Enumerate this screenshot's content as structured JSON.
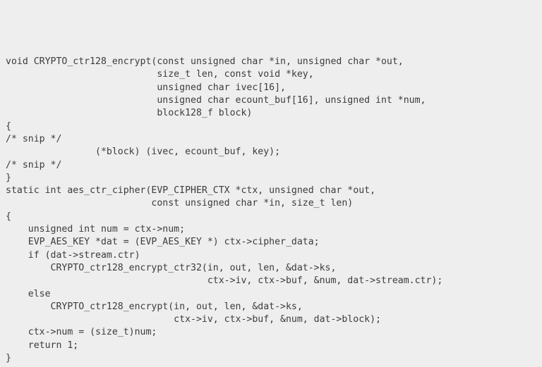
{
  "code": {
    "lines": [
      "void CRYPTO_ctr128_encrypt(const unsigned char *in, unsigned char *out,",
      "                           size_t len, const void *key,",
      "                           unsigned char ivec[16],",
      "                           unsigned char ecount_buf[16], unsigned int *num,",
      "                           block128_f block)",
      "{",
      "/* snip */",
      "                (*block) (ivec, ecount_buf, key);",
      "/* snip */",
      "}",
      "",
      "static int aes_ctr_cipher(EVP_CIPHER_CTX *ctx, unsigned char *out,",
      "                          const unsigned char *in, size_t len)",
      "{",
      "    unsigned int num = ctx->num;",
      "    EVP_AES_KEY *dat = (EVP_AES_KEY *) ctx->cipher_data;",
      "",
      "    if (dat->stream.ctr)",
      "        CRYPTO_ctr128_encrypt_ctr32(in, out, len, &dat->ks,",
      "                                    ctx->iv, ctx->buf, &num, dat->stream.ctr);",
      "    else",
      "        CRYPTO_ctr128_encrypt(in, out, len, &dat->ks,",
      "                              ctx->iv, ctx->buf, &num, dat->block);",
      "    ctx->num = (size_t)num;",
      "    return 1;",
      "}"
    ]
  }
}
